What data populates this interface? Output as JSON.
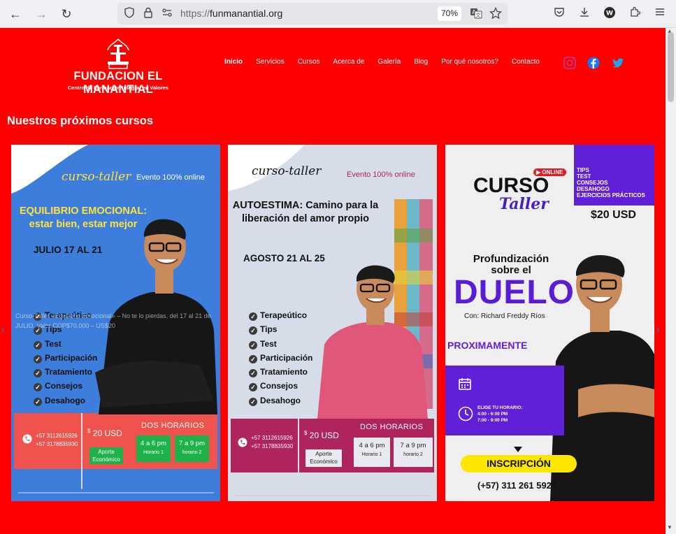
{
  "browser": {
    "url_protocol": "https://",
    "url_domain": "funmanantial.org",
    "zoom": "70%"
  },
  "site": {
    "brand_name": "FUNDACION EL MANANTIAL",
    "tagline": "Centro de Formación Integral en Valores",
    "menu": [
      {
        "label": "Inicio",
        "active": true
      },
      {
        "label": "Servicios"
      },
      {
        "label": "Cursos"
      },
      {
        "label": "Acerca de"
      },
      {
        "label": "Galería"
      },
      {
        "label": "Blog"
      },
      {
        "label": "Por qué nosotros?"
      },
      {
        "label": "Contacto"
      }
    ],
    "social": [
      "instagram-icon",
      "facebook-icon",
      "twitter-icon"
    ],
    "section_title": "Nuestros próximos cursos",
    "colors": {
      "background": "#ff0000",
      "instagram": "#c13584",
      "facebook": "#1877f2",
      "twitter": "#1da1f2"
    }
  },
  "carousel": {
    "prev": "‹",
    "next": "›",
    "card1": {
      "script": "curso-taller",
      "online": "Evento 100% online",
      "title_line1": "EQUILIBRIO EMOCIONAL:",
      "title_line2": "estar bien, estar mejor",
      "dates": "JULIO 17 AL 21",
      "items": [
        "Terapeútico",
        "Tips",
        "Test",
        "Participación",
        "Tratamiento",
        "Consejos",
        "Desahogo"
      ],
      "phone1": "+57 3112615926",
      "phone2": "+57 3178835930",
      "price_symbol": "$",
      "price": "20 USD",
      "aporte": "Aporte Económico",
      "dos_horarios": "DOS HORARIOS",
      "h1_time": "4 a 6 pm",
      "h1_label": "Horario 1",
      "h2_time": "7 a 9 pm",
      "h2_label": "horario 2",
      "overlay_caption": "Curso-Taller «Equilibrio Emocional» – No te lo pierdas, del 17 al 21 de JULIO. Valor COP$70.000 – US$20"
    },
    "card2": {
      "script": "curso-taller",
      "online": "Evento 100% online",
      "title_line1": "AUTOESTIMA: Camino para la",
      "title_line2": "liberación del amor propio",
      "dates": "AGOSTO 21 AL 25",
      "items": [
        "Terapeútico",
        "Tips",
        "Test",
        "Participación",
        "Tratamiento",
        "Consejos",
        "Desahogo"
      ],
      "phone1": "+57 3112615926",
      "phone2": "+57 3178835930",
      "price_symbol": "$",
      "price": "20 USD",
      "aporte": "Aporte Económico",
      "dos_horarios": "DOS HORARIOS",
      "h1_time": "4 a 6 pm",
      "h1_label": "Horario 1",
      "h2_time": "7 a 9 pm",
      "h2_label": "horario 2"
    },
    "card3": {
      "online": "ONLINE",
      "curso": "CURSO",
      "taller": "Taller",
      "tags": [
        "TIPS",
        "TEST",
        "CONSEJOS",
        "DESAHOGO",
        "EJERCICIOS PRÁCTICOS"
      ],
      "price": "$20 USD",
      "profund_line1": "Profundización",
      "profund_line2": "sobre el",
      "duelo": "DUELO",
      "con": "Con: Richard Freddy Ríos",
      "proximamente": "PROXIMAMENTE",
      "elige": "ELIGE TU HORARIO:",
      "h1": "4:00 - 6:00 PM",
      "h2": "7:00 - 9:00 PM",
      "inscripcion": "INSCRIPCIÓN",
      "telefono": "(+57) 311 261 5926"
    }
  }
}
